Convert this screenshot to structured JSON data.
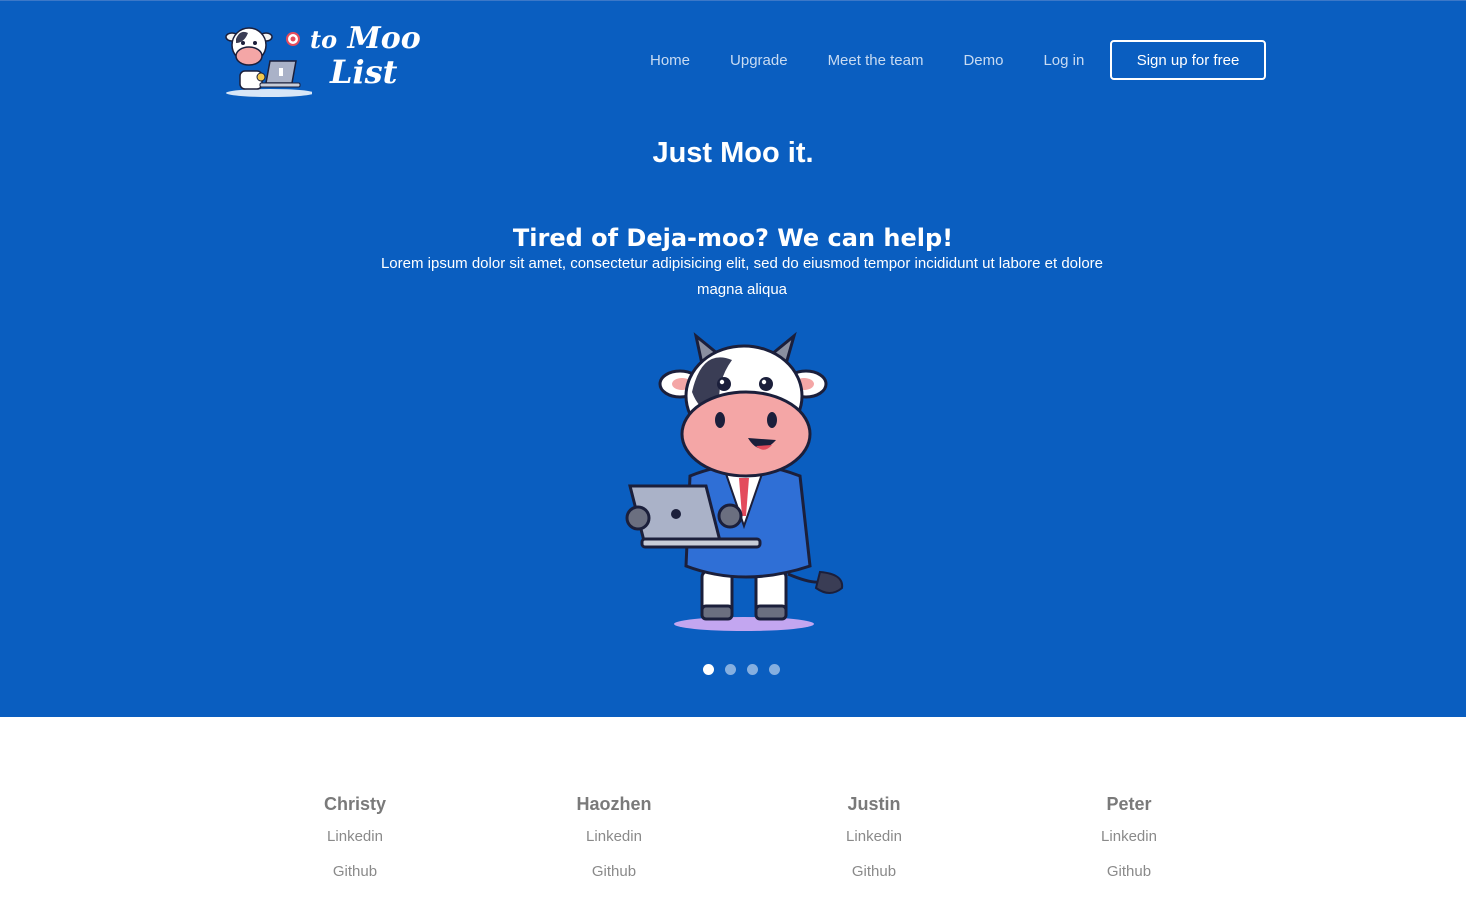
{
  "brand": {
    "logo_line1_a": "to",
    "logo_line1_b": "Moo",
    "logo_line2": "List"
  },
  "nav": {
    "items": [
      {
        "label": "Home"
      },
      {
        "label": "Upgrade"
      },
      {
        "label": "Meet the team"
      },
      {
        "label": "Demo"
      },
      {
        "label": "Log in"
      }
    ],
    "cta_label": "Sign up for free"
  },
  "hero": {
    "headline": "Just Moo it.",
    "subheadline": "Tired of Deja-moo? We can help!",
    "description": "Lorem ipsum dolor sit amet, consectetur adipisicing elit, sed do eiusmod tempor incididunt ut labore et dolore magna aliqua",
    "carousel": {
      "total": 4,
      "active": 1
    }
  },
  "team": [
    {
      "name": "Christy",
      "linkedin": "Linkedin",
      "github": "Github"
    },
    {
      "name": "Haozhen",
      "linkedin": "Linkedin",
      "github": "Github"
    },
    {
      "name": "Justin",
      "linkedin": "Linkedin",
      "github": "Github"
    },
    {
      "name": "Peter",
      "linkedin": "Linkedin",
      "github": "Github"
    }
  ],
  "colors": {
    "brand_blue": "#0a5ec0",
    "text_white": "#ffffff",
    "team_gray": "#7a7a7a"
  }
}
